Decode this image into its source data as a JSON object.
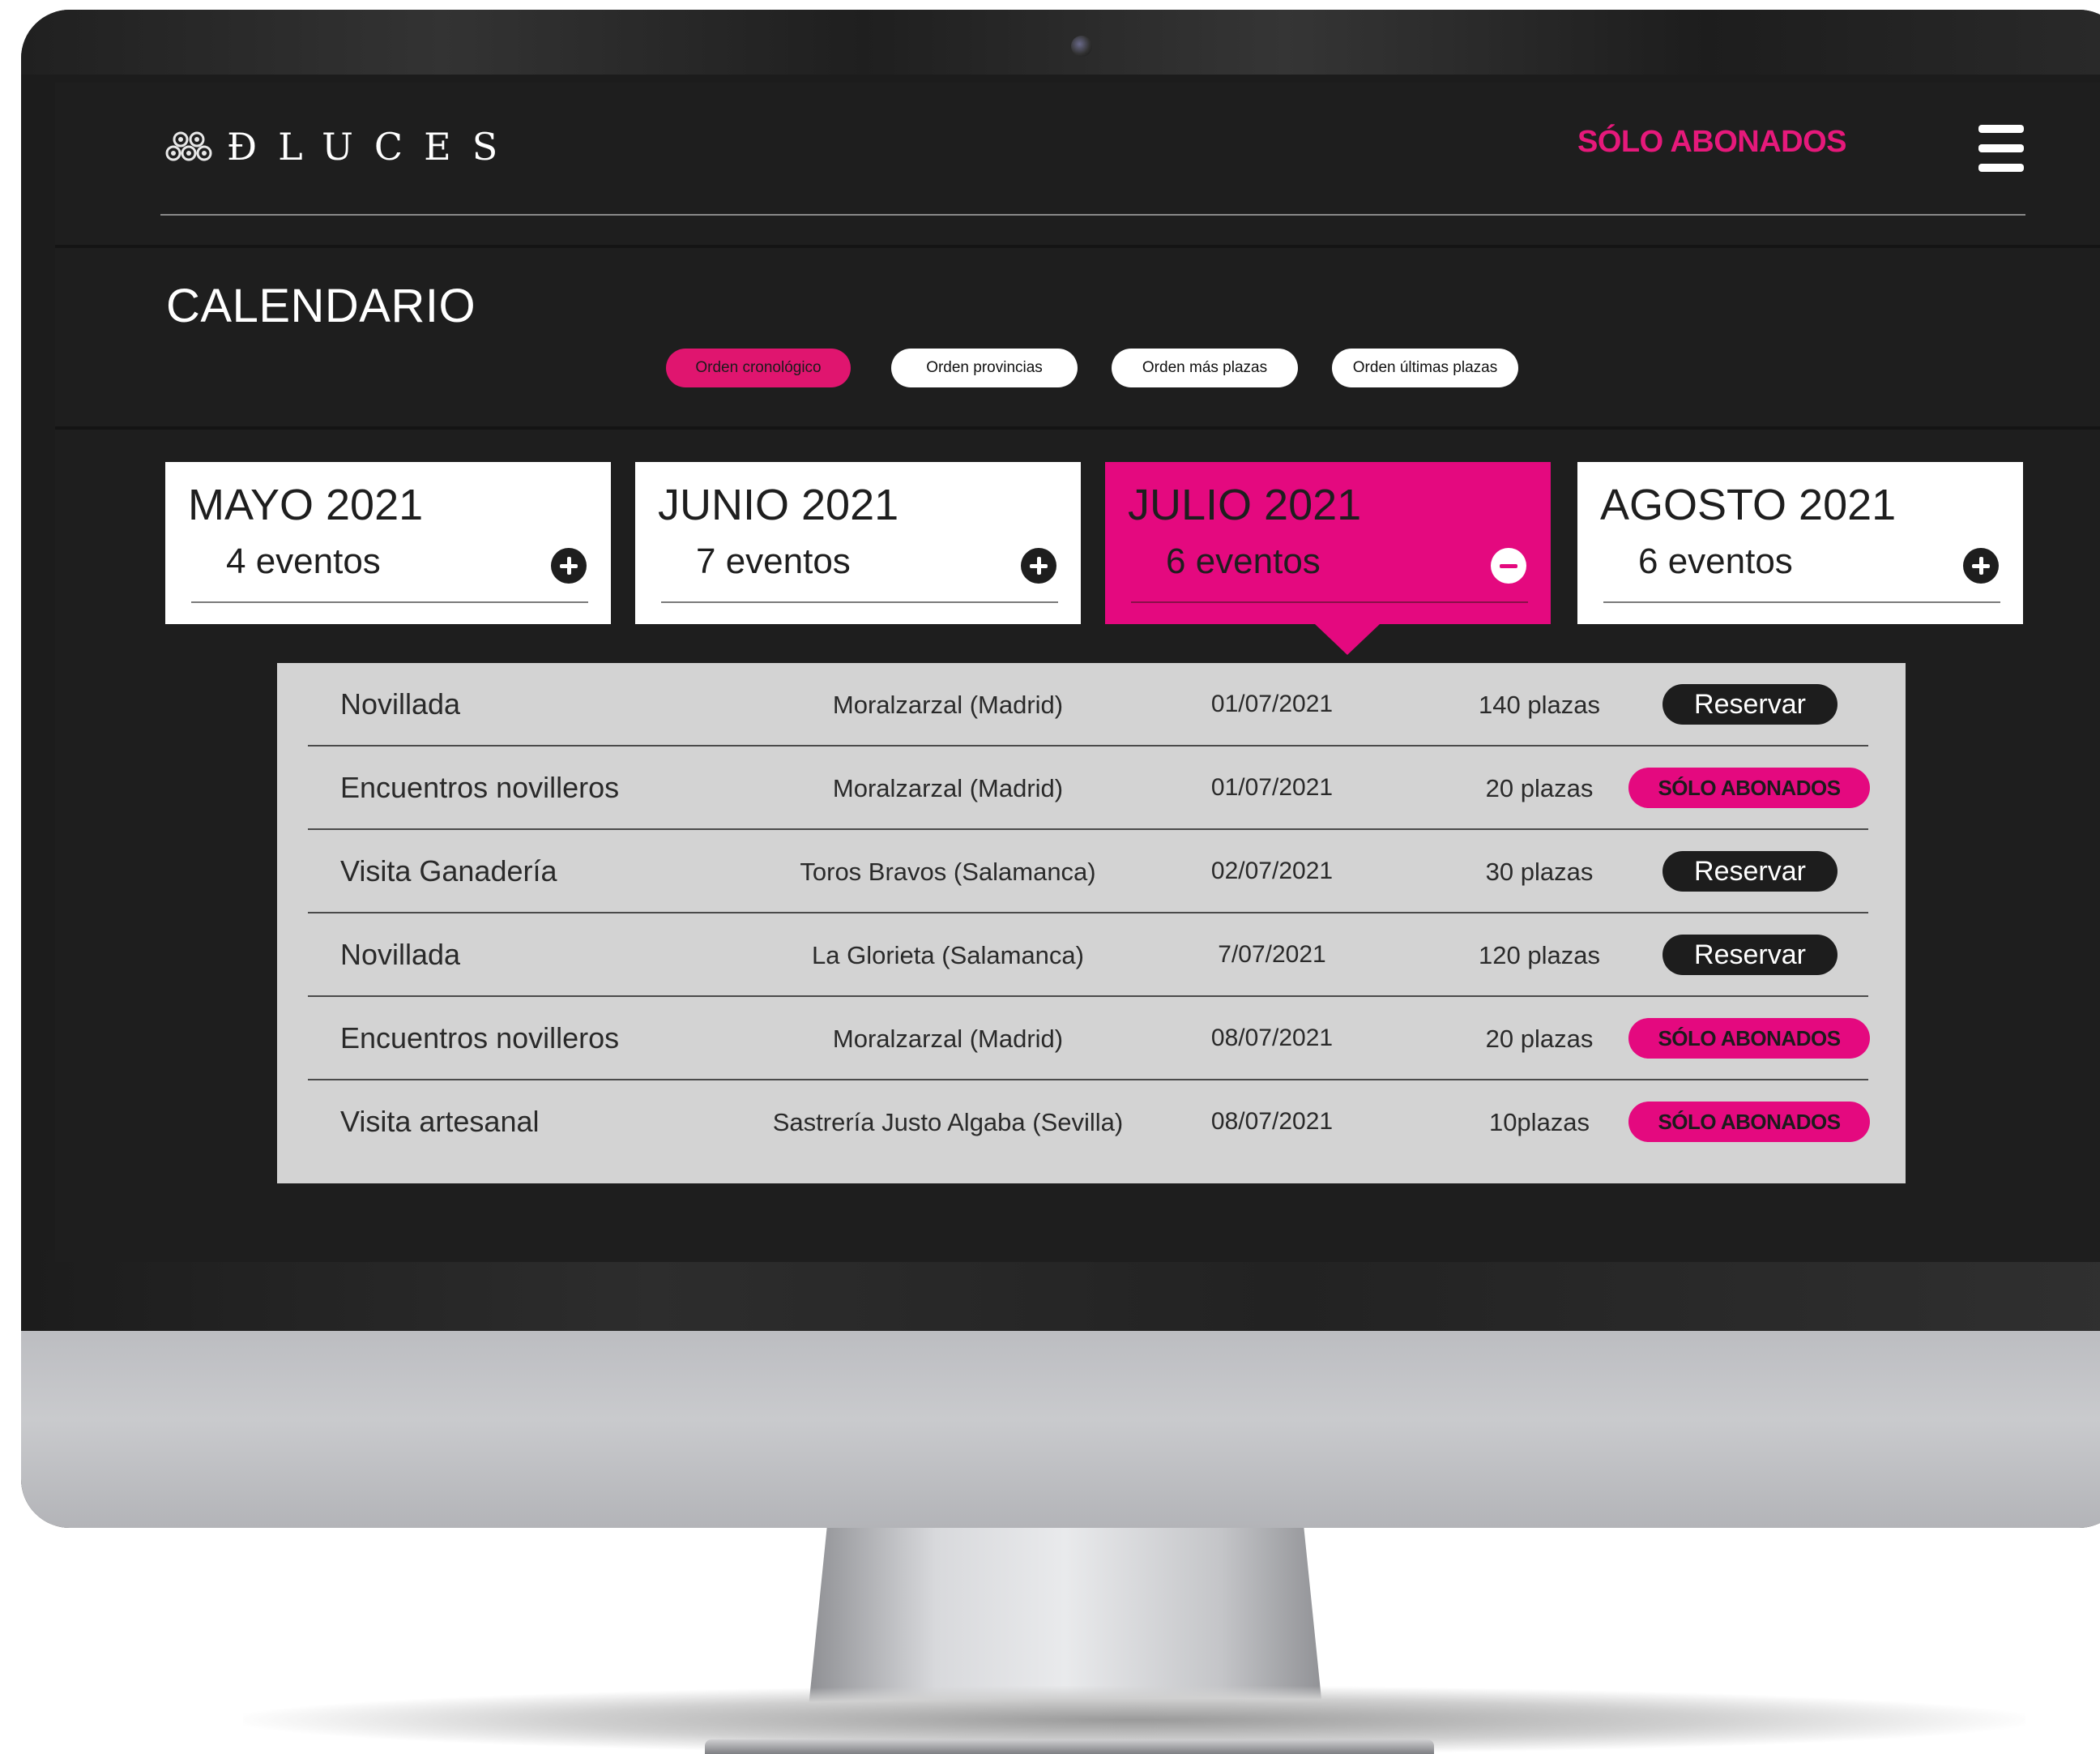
{
  "brand": {
    "logo_text": "ÐLUCES"
  },
  "header": {
    "members_link": "SÓLO ABONADOS"
  },
  "page": {
    "title": "CALENDARIO"
  },
  "sort_options": [
    {
      "label": "Orden cronológico",
      "active": true
    },
    {
      "label": "Orden provincias",
      "active": false
    },
    {
      "label": "Orden más plazas",
      "active": false
    },
    {
      "label": "Orden últimas plazas",
      "active": false
    }
  ],
  "months": [
    {
      "title": "MAYO 2021",
      "count": "4 eventos",
      "state": "collapsed",
      "icon": "plus-circle-icon"
    },
    {
      "title": "JUNIO 2021",
      "count": "7 eventos",
      "state": "collapsed",
      "icon": "plus-circle-icon"
    },
    {
      "title": "JULIO 2021",
      "count": "6 eventos",
      "state": "expanded",
      "icon": "minus-circle-icon"
    },
    {
      "title": "AGOSTO 2021",
      "count": "6 eventos",
      "state": "collapsed",
      "icon": "plus-circle-icon"
    }
  ],
  "events": [
    {
      "name": "Novillada",
      "place": "Moralzarzal (Madrid)",
      "date": "01/07/2021",
      "seats": "140 plazas",
      "action": "Reservar",
      "action_type": "reserve"
    },
    {
      "name": "Encuentros novilleros",
      "place": "Moralzarzal (Madrid)",
      "date": "01/07/2021",
      "seats": "20 plazas",
      "action": "SÓLO ABONADOS",
      "action_type": "members"
    },
    {
      "name": "Visita Ganadería",
      "place": "Toros Bravos (Salamanca)",
      "date": "02/07/2021",
      "seats": "30 plazas",
      "action": "Reservar",
      "action_type": "reserve"
    },
    {
      "name": "Novillada",
      "place": "La Glorieta (Salamanca)",
      "date": "7/07/2021",
      "seats": "120 plazas",
      "action": "Reservar",
      "action_type": "reserve"
    },
    {
      "name": "Encuentros novilleros",
      "place": "Moralzarzal (Madrid)",
      "date": "08/07/2021",
      "seats": "20 plazas",
      "action": "SÓLO ABONADOS",
      "action_type": "members"
    },
    {
      "name": "Visita artesanal",
      "place": "Sastrería Justo Algaba (Sevilla)",
      "date": "08/07/2021",
      "seats": "10plazas",
      "action": "SÓLO ABONADOS",
      "action_type": "members"
    }
  ],
  "colors": {
    "accent": "#e4097f",
    "background": "#1e1e1e",
    "panel": "#d3d3d3"
  }
}
